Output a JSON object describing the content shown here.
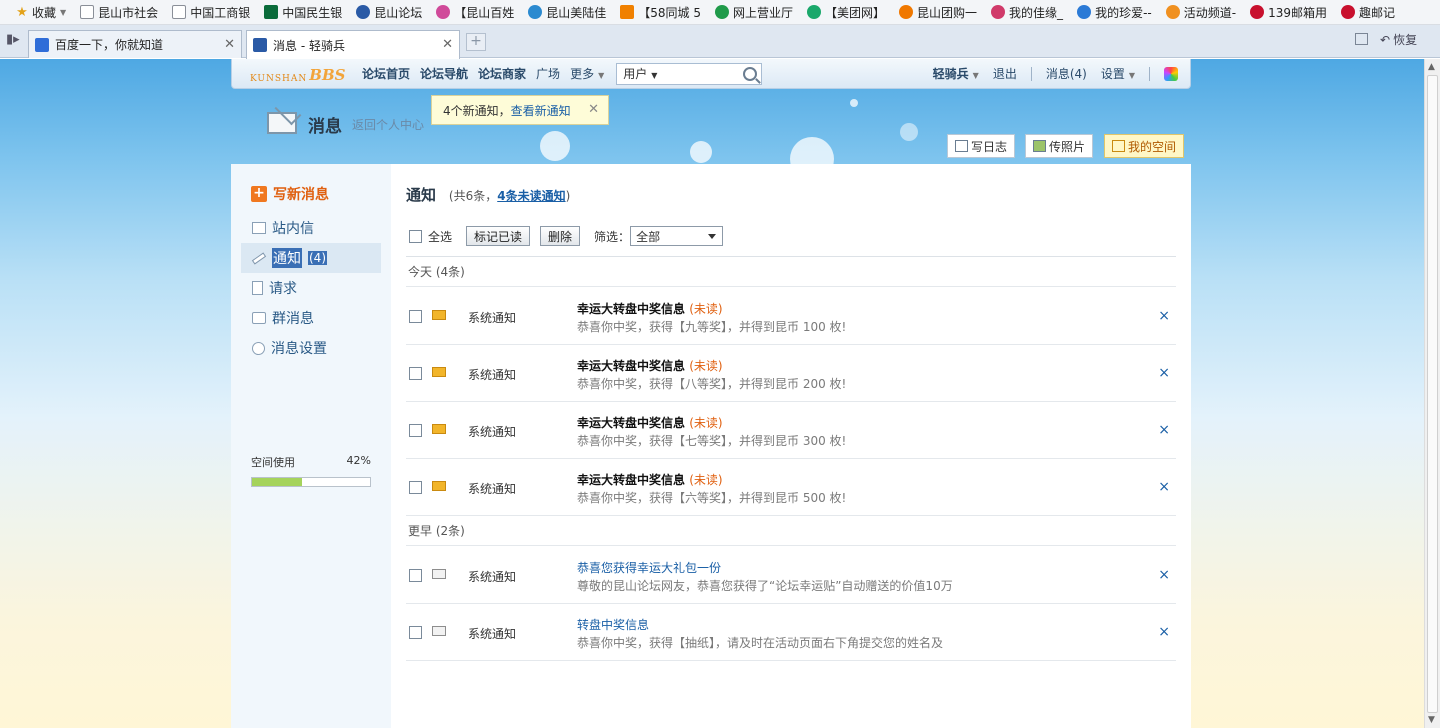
{
  "bookmarks": [
    {
      "label": "收藏",
      "icon": "star-icon",
      "menu": true
    },
    {
      "label": "昆山市社会",
      "icon": "page-icon"
    },
    {
      "label": "中国工商银",
      "icon": "page-icon"
    },
    {
      "label": "中国民生银",
      "icon": "bank-icon"
    },
    {
      "label": "昆山论坛",
      "icon": "bbs-icon"
    },
    {
      "label": "【昆山百姓",
      "icon": "flower-icon"
    },
    {
      "label": "昆山美陆佳",
      "icon": "globe-icon"
    },
    {
      "label": "【58同城 5",
      "icon": "58-icon",
      "prefix": "58"
    },
    {
      "label": "网上营业厅",
      "icon": "mobile-icon"
    },
    {
      "label": "【美团网】",
      "icon": "meituan-icon"
    },
    {
      "label": "昆山团购一",
      "icon": "tuangou-icon"
    },
    {
      "label": "我的佳缘_",
      "icon": "jiayuan-icon"
    },
    {
      "label": "我的珍爱--",
      "icon": "zhenai-icon"
    },
    {
      "label": "活动频道-",
      "icon": "activity-icon"
    },
    {
      "label": "139邮箱用",
      "icon": "mail139-icon"
    },
    {
      "label": "趣邮记",
      "icon": "quyouji-icon"
    }
  ],
  "tabs": [
    {
      "title": "百度一下，你就知道",
      "active": false
    },
    {
      "title": "消息 - 轻骑兵",
      "active": true
    }
  ],
  "window": {
    "restore_label": "恢复"
  },
  "site": {
    "logo_small": "KUNSHAN",
    "logo_big": "BBS",
    "nav": [
      {
        "label": "论坛首页",
        "bold": true
      },
      {
        "label": "论坛导航",
        "bold": true
      },
      {
        "label": "论坛商家",
        "bold": true
      },
      {
        "label": "广场",
        "bold": false
      },
      {
        "label": "更多",
        "bold": false
      }
    ],
    "search_scope": "用户",
    "username": "轻骑兵",
    "logout": "退出",
    "messages": "消息(4)",
    "settings": "设置"
  },
  "tip": {
    "text": "4个新通知，",
    "link": "查看新通知"
  },
  "header": {
    "title": "消息",
    "back": "返回个人中心",
    "buttons": [
      "写日志",
      "传照片",
      "我的空间"
    ]
  },
  "sidebar": {
    "write": "写新消息",
    "items": [
      {
        "label": "站内信",
        "count": ""
      },
      {
        "label": "通知",
        "count": "(4)"
      },
      {
        "label": "请求",
        "count": ""
      },
      {
        "label": "群消息",
        "count": ""
      },
      {
        "label": "消息设置",
        "count": ""
      }
    ],
    "usage_label": "空间使用",
    "usage_percent_text": "42%",
    "usage_fraction": 0.42
  },
  "content": {
    "title": "通知",
    "summary_prefix": "(共6条，",
    "summary_link": "4条未读通知",
    "summary_suffix": ")",
    "select_all": "全选",
    "mark_read": "标记已读",
    "delete": "删除",
    "filter_label": "筛选：",
    "filter_value": "全部",
    "groups": [
      {
        "label": "今天 (4条)",
        "rows": [
          {
            "source": "系统通知",
            "title": "幸运大转盘中奖信息",
            "tag": "(未读)",
            "desc": "恭喜你中奖，获得【九等奖】，并得到昆币 100 枚!",
            "read": false,
            "link": false
          },
          {
            "source": "系统通知",
            "title": "幸运大转盘中奖信息",
            "tag": "(未读)",
            "desc": "恭喜你中奖，获得【八等奖】，并得到昆币 200 枚!",
            "read": false,
            "link": false
          },
          {
            "source": "系统通知",
            "title": "幸运大转盘中奖信息",
            "tag": "(未读)",
            "desc": "恭喜你中奖，获得【七等奖】，并得到昆币 300 枚!",
            "read": false,
            "link": false
          },
          {
            "source": "系统通知",
            "title": "幸运大转盘中奖信息",
            "tag": "(未读)",
            "desc": "恭喜你中奖，获得【六等奖】，并得到昆币 500 枚!",
            "read": false,
            "link": false
          }
        ]
      },
      {
        "label": "更早 (2条)",
        "rows": [
          {
            "source": "系统通知",
            "title": "恭喜您获得幸运大礼包一份",
            "tag": "",
            "desc": "尊敬的昆山论坛网友，恭喜您获得了“论坛幸运贴”自动赠送的价值10万",
            "read": true,
            "link": true
          },
          {
            "source": "系统通知",
            "title": "转盘中奖信息",
            "tag": "",
            "desc": "恭喜你中奖，获得【抽纸】，请及时在活动页面右下角提交您的姓名及",
            "read": true,
            "link": true
          }
        ]
      }
    ],
    "delete_glyph": "×"
  },
  "colors": {
    "accent": "#1a5fa6",
    "unread": "#e06010",
    "usage_fill": "#a5d35b"
  }
}
